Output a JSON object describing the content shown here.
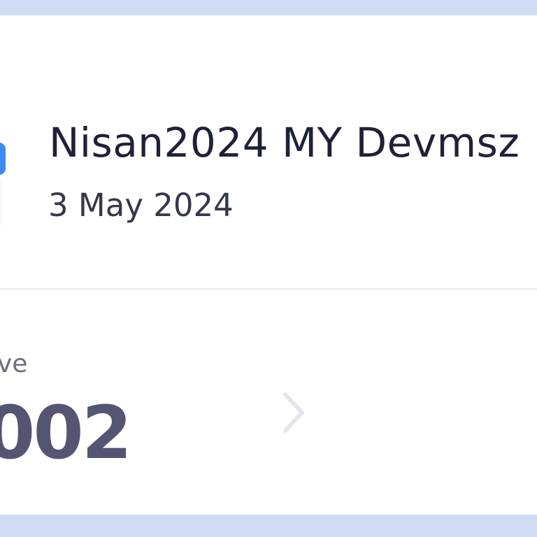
{
  "card": {
    "title": "Nisan2024 MY Devmsz",
    "date": "3 May 2024"
  },
  "stat": {
    "label": "ve",
    "value": "002"
  },
  "icons": {
    "app": "app-icon",
    "chevron": "chevron-right-icon"
  },
  "colors": {
    "background": "#cfdcf3",
    "card": "#ffffff",
    "title": "#1e2238",
    "value": "#535572",
    "accent": "#3d8cf5"
  }
}
